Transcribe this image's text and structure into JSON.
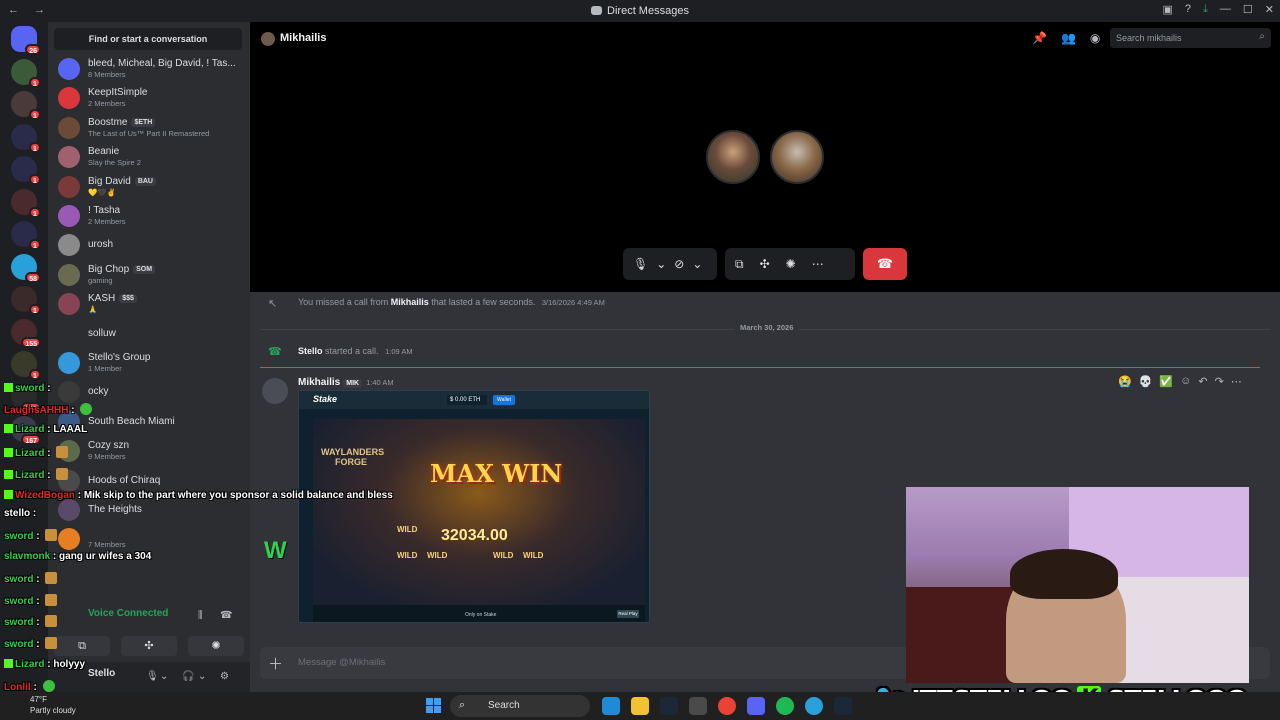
{
  "window": {
    "title": "Direct Messages"
  },
  "rail": {
    "servers": [
      {
        "badge": "26"
      },
      {
        "badge": "1"
      },
      {
        "badge": "1"
      },
      {
        "badge": "1"
      },
      {
        "badge": "1"
      },
      {
        "badge": "1"
      },
      {
        "badge": "1"
      },
      {
        "badge": "58"
      },
      {
        "badge": "1"
      },
      {
        "badge": "155"
      },
      {
        "badge": "1"
      },
      {
        "badge": "380"
      },
      {
        "badge": "167"
      }
    ]
  },
  "sidebar": {
    "find": "Find or start a conversation",
    "dms": [
      {
        "name": "bleed, Micheal, Big David, ! Tas...",
        "sub": "8 Members",
        "tag": "",
        "color": "#5865f2"
      },
      {
        "name": "KeepItSimple",
        "sub": "2 Members",
        "tag": "",
        "color": "#da373c"
      },
      {
        "name": "Boostme",
        "sub": "The Last of Us™ Part II Remastered",
        "tag": "$ETH",
        "color": "#6b4a3a"
      },
      {
        "name": "Beanie",
        "sub": "Slay the Spire 2",
        "tag": "",
        "color": "#a06070"
      },
      {
        "name": "Big David",
        "sub": "💛🖤✌",
        "tag": "BAU",
        "color": "#7a3a3a"
      },
      {
        "name": "! Tasha",
        "sub": "2 Members",
        "tag": "",
        "color": "#9b59b6"
      },
      {
        "name": "urosh",
        "sub": "",
        "tag": "",
        "color": "#8a8a8a"
      },
      {
        "name": "Big Chop",
        "sub": "gaming",
        "tag": "SOM",
        "color": "#6a6a50"
      },
      {
        "name": "KASH",
        "sub": "🙏",
        "tag": "$$$",
        "color": "#884455"
      },
      {
        "name": "solluw",
        "sub": "",
        "tag": "",
        "color": "#2b2d31"
      },
      {
        "name": "Stello's Group",
        "sub": "1 Member",
        "tag": "",
        "color": "#3498db"
      },
      {
        "name": "ocky",
        "sub": "",
        "tag": "",
        "color": "#3a3a3a"
      },
      {
        "name": "South Beach Miami",
        "sub": "",
        "tag": "",
        "color": "#3a5a8a"
      },
      {
        "name": "Cozy szn",
        "sub": "9 Members",
        "tag": "",
        "color": "#5a6a4a"
      },
      {
        "name": "Hoods of Chiraq",
        "sub": "",
        "tag": "",
        "color": "#4a4a4a"
      },
      {
        "name": "The Heights",
        "sub": "",
        "tag": "",
        "color": "#5a4a6a"
      },
      {
        "name": "",
        "sub": "7 Members",
        "tag": "",
        "color": "#e67e22"
      }
    ],
    "voice_connected": "Voice Connected",
    "user_name": "Stello"
  },
  "header": {
    "dm_name": "Mikhailis",
    "search_placeholder": "Search mikhailis"
  },
  "chat": {
    "missed_call": {
      "pre": "You missed a call from",
      "name": "Mikhailis",
      "post": "that lasted a few seconds.",
      "time": "3/16/2026 4:49 AM"
    },
    "date_divider": "March 30, 2026",
    "started_call": {
      "name": "Stello",
      "post": "started a call.",
      "time": "1:09 AM"
    },
    "message": {
      "author": "Mikhailis",
      "tag": "MIK",
      "time": "1:40 AM"
    },
    "input_placeholder": "Message @Mikhailis"
  },
  "embed": {
    "logo": "Stake",
    "wallet": "$ 0.00 ETH",
    "deposit": "Wallet",
    "forge": "WAYLANDERS FORGE",
    "max_win": "MAX WIN",
    "amount": "32034.00",
    "wild": "WILD",
    "only_on": "Only on Stake",
    "real_play": "Real Play"
  },
  "overlay": {
    "big_w": "W",
    "brand_twitter": "ITZSTELLOO",
    "brand_kick": "STELLOOO",
    "chat": [
      {
        "user": "sword",
        "color": "#2fd24a",
        "text": "",
        "emote": "",
        "kick": true
      },
      {
        "user": "LaughsAHHH",
        "color": "#e0282b",
        "text": "",
        "emote": "g",
        "kick": false
      },
      {
        "user": "Lizard",
        "color": "#2fd24a",
        "text": "LAAAL",
        "emote": "",
        "kick": true
      },
      {
        "user": "Lizard",
        "color": "#2fd24a",
        "text": "",
        "emote": "o",
        "kick": true
      },
      {
        "user": "Lizard",
        "color": "#2fd24a",
        "text": "",
        "emote": "o",
        "kick": true
      },
      {
        "user": "WizedBogan",
        "color": "#e0282b",
        "text": "Mik skip to the part where you sponsor a solid balance and bless",
        "emote": "",
        "kick": true
      },
      {
        "user": "stello",
        "color": "#ffffff",
        "text": "",
        "emote": "",
        "kick": false
      },
      {
        "user": "sword",
        "color": "#2fd24a",
        "text": "",
        "emote": "o",
        "kick": false
      },
      {
        "user": "slavmonk",
        "color": "#2fd24a",
        "text": "gang ur wifes a 304",
        "emote": "",
        "kick": false
      },
      {
        "user": "sword",
        "color": "#2fd24a",
        "text": "",
        "emote": "o",
        "kick": false
      },
      {
        "user": "sword",
        "color": "#2fd24a",
        "text": "",
        "emote": "o",
        "kick": false
      },
      {
        "user": "sword",
        "color": "#2fd24a",
        "text": "",
        "emote": "o",
        "kick": false
      },
      {
        "user": "sword",
        "color": "#2fd24a",
        "text": "",
        "emote": "o",
        "kick": false
      },
      {
        "user": "Lizard",
        "color": "#2fd24a",
        "text": "holyyy",
        "emote": "",
        "kick": true
      },
      {
        "user": "Lonlil",
        "color": "#e0282b",
        "text": "",
        "emote": "g",
        "kick": false
      },
      {
        "user": "LaughsAHHH",
        "color": "#e0282b",
        "text": "W",
        "emote": "",
        "kick": false
      }
    ]
  },
  "taskbar": {
    "temp": "47°F",
    "weather": "Partly cloudy",
    "search": "Search"
  }
}
